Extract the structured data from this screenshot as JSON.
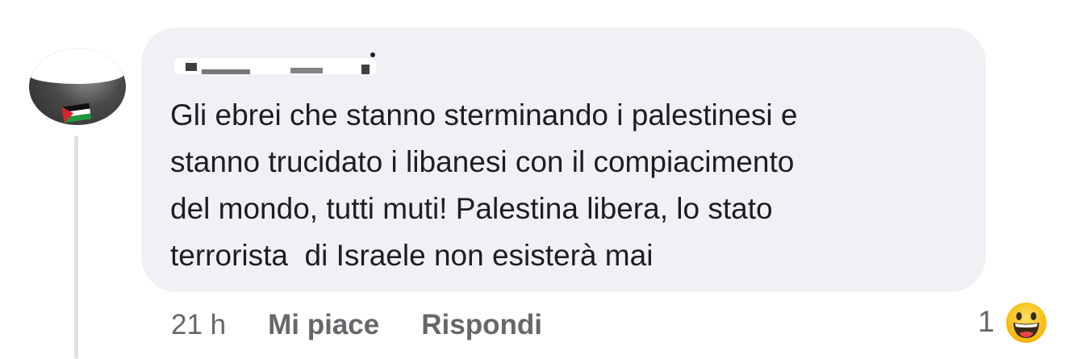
{
  "comment": {
    "text": "Gli ebrei che stanno sterminando i palestinesi e\nstanno trucidato i libanesi con il compiacimento\ndel mondo, tutti muti! Palestina libera, lo stato\nterrorista  di Israele non esisterà mai",
    "author_name_redacted": true
  },
  "actions": {
    "time": "21 h",
    "like_label": "Mi piace",
    "reply_label": "Rispondi"
  },
  "reactions": {
    "count": "1",
    "emoji_icon": "grinning-sweat-emoji-icon"
  },
  "colors": {
    "bubble_bg": "#f0f1f5",
    "text": "#1c1e21",
    "secondary_text": "#65676b",
    "thread_line": "#dfe1e5"
  }
}
